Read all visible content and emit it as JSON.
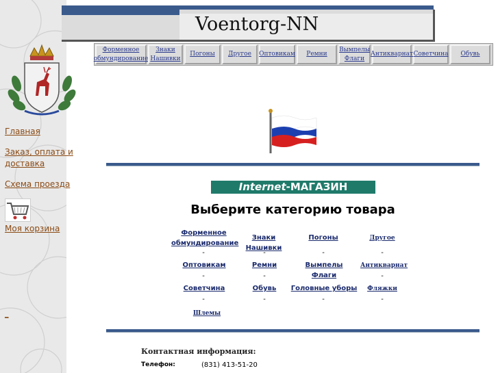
{
  "header": {
    "site_title": "Voentorg-NN"
  },
  "top_nav": [
    "Форменное обмундирование",
    "Знаки Нашивки",
    "Погоны",
    "Другое",
    "Оптовикам",
    "Ремни",
    "Вымпелы Флаги",
    "Антикварнат",
    "Советчина",
    "Обувь"
  ],
  "left_nav": {
    "home": "Главная",
    "order": "Заказ, оплата и доставка",
    "map": "Схема проезда",
    "cart": "Моя корзина",
    "dash": "_"
  },
  "main": {
    "shop_label_prefix": "Internet",
    "shop_label_suffix": "-МАГАЗИН",
    "category_title": "Выберите категорию товара",
    "categories": [
      "Форменное обмундирование",
      "Знаки Нашивки",
      "Погоны",
      "Другое",
      "Оптовикам",
      "Ремни",
      "Вымпелы Флаги",
      "Антикварнат",
      "Советчина",
      "Обувь",
      "Головные уборы",
      "Фляжки",
      "Шлемы"
    ],
    "dash": "-"
  },
  "contact": {
    "title": "Контактная информация:",
    "phone_label": "Телефон:",
    "phone_value": "(831) 413-51-20"
  },
  "colors": {
    "link": "#8a4a14",
    "accent_blue": "#3a5a8c",
    "shop_label_bg": "#1f7a6a"
  }
}
